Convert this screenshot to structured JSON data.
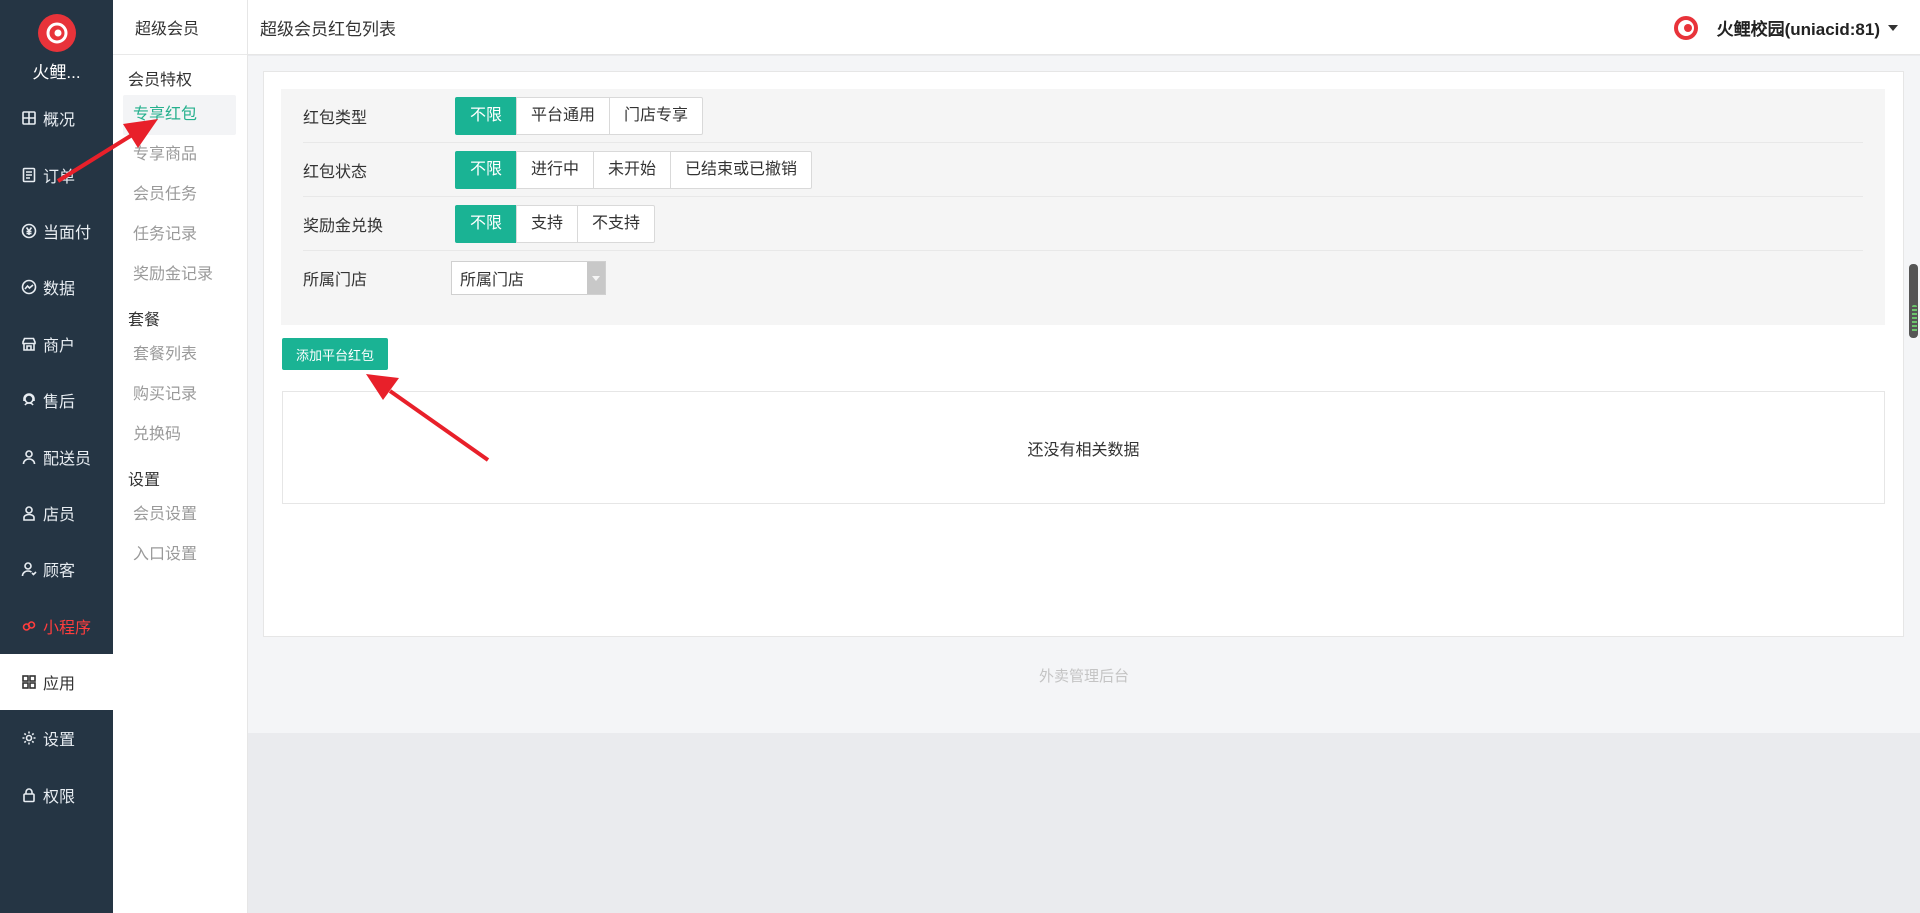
{
  "colors": {
    "sidebar_bg": "#253544",
    "accent": "#1ab394",
    "red": "#e8333a",
    "annotation": "#e8202a"
  },
  "sidebar": {
    "brand_name": "火鲤...",
    "items": [
      {
        "label": "概况",
        "icon": "dashboard-icon"
      },
      {
        "label": "订单",
        "icon": "order-list-icon"
      },
      {
        "label": "当面付",
        "icon": "yuan-coin-icon"
      },
      {
        "label": "数据",
        "icon": "chart-line-icon"
      },
      {
        "label": "商户",
        "icon": "store-icon"
      },
      {
        "label": "售后",
        "icon": "headset-icon"
      },
      {
        "label": "配送员",
        "icon": "rider-icon"
      },
      {
        "label": "店员",
        "icon": "clerk-icon"
      },
      {
        "label": "顾客",
        "icon": "customer-icon"
      },
      {
        "label": "小程序",
        "icon": "miniprogram-icon"
      },
      {
        "label": "应用",
        "icon": "apps-grid-icon"
      },
      {
        "label": "设置",
        "icon": "gear-icon"
      },
      {
        "label": "权限",
        "icon": "lock-icon"
      }
    ]
  },
  "subnav": {
    "title": "超级会员",
    "groups": [
      {
        "title": "会员特权",
        "items": [
          "专享红包",
          "专享商品",
          "会员任务",
          "任务记录",
          "奖励金记录"
        ]
      },
      {
        "title": "套餐",
        "items": [
          "套餐列表",
          "购买记录",
          "兑换码"
        ]
      },
      {
        "title": "设置",
        "items": [
          "会员设置",
          "入口设置"
        ]
      }
    ]
  },
  "header": {
    "title": "超级会员红包列表",
    "account": "火鲤校园(uniacid:81)"
  },
  "filters": {
    "type": {
      "label": "红包类型",
      "options": [
        "不限",
        "平台通用",
        "门店专享"
      ],
      "selected": "不限"
    },
    "status": {
      "label": "红包状态",
      "options": [
        "不限",
        "进行中",
        "未开始",
        "已结束或已撤销"
      ],
      "selected": "不限"
    },
    "exchange": {
      "label": "奖励金兑换",
      "options": [
        "不限",
        "支持",
        "不支持"
      ],
      "selected": "不限"
    },
    "store": {
      "label": "所属门店",
      "value": "所属门店"
    }
  },
  "actions": {
    "add_label": "添加平台红包"
  },
  "table": {
    "empty_text": "还没有相关数据"
  },
  "footer": {
    "text": "外卖管理后台"
  }
}
